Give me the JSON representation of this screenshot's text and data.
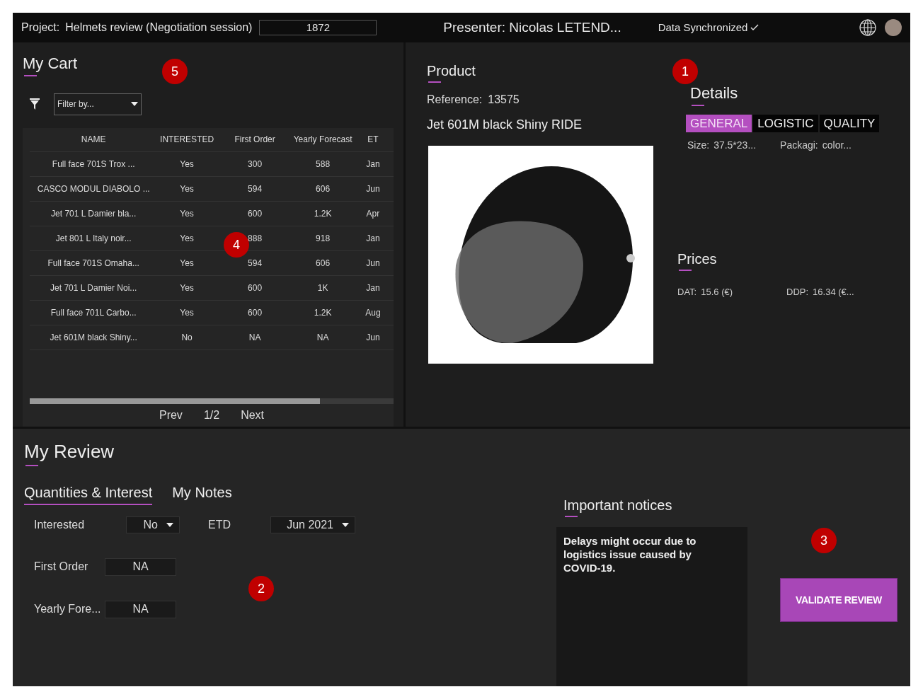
{
  "top_bar": {
    "project_label": "Project:",
    "project_name": "Helmets review (Negotiation session)",
    "project_code": "1872",
    "presenter": "Presenter: Nicolas LETEND...",
    "sync_status": "Data Synchronized"
  },
  "cart": {
    "title": "My Cart",
    "filter": {
      "placeholder": "Filter by..."
    },
    "table": {
      "columns": [
        "NAME",
        "INTERESTED",
        "First Order",
        "Yearly Forecast",
        "ET"
      ],
      "rows": [
        [
          "Full face 701S Trox ...",
          "Yes",
          "300",
          "588",
          "Jan"
        ],
        [
          "CASCO MODUL DIABOLO ...",
          "Yes",
          "594",
          "606",
          "Jun"
        ],
        [
          "Jet 701 L Damier bla...",
          "Yes",
          "600",
          "1.2K",
          "Apr"
        ],
        [
          "Jet 801 L Italy noir...",
          "Yes",
          "888",
          "918",
          "Jan"
        ],
        [
          "Full face 701S Omaha...",
          "Yes",
          "594",
          "606",
          "Jun"
        ],
        [
          "Jet 701 L Damier Noi...",
          "Yes",
          "600",
          "1K",
          "Jan"
        ],
        [
          "Full face 701L Carbo...",
          "Yes",
          "600",
          "1.2K",
          "Aug"
        ],
        [
          "Jet 601M black Shiny...",
          "No",
          "NA",
          "NA",
          "Jun"
        ]
      ]
    },
    "pagination": {
      "prev": "Prev",
      "page": "1/2",
      "next": "Next"
    }
  },
  "product": {
    "title": "Product",
    "reference_label": "Reference:",
    "reference": "13575",
    "name": "Jet 601M black Shiny RIDE",
    "details": {
      "title": "Details",
      "tabs": [
        {
          "label": "GENERAL",
          "selected": true
        },
        {
          "label": "LOGISTIC",
          "selected": false
        },
        {
          "label": "QUALITY",
          "selected": false
        }
      ],
      "fields": [
        {
          "label": "Size:",
          "value": "37.5*23..."
        },
        {
          "label": "Packagi:",
          "value": "color..."
        }
      ]
    },
    "prices": {
      "title": "Prices",
      "fields": [
        {
          "label": "DAT:",
          "value": "15.6 (€)"
        },
        {
          "label": "DDP:",
          "value": "16.34 (€..."
        }
      ]
    }
  },
  "review": {
    "title": "My Review",
    "tabs": [
      {
        "label": "Quantities & Interest",
        "selected": true
      },
      {
        "label": "My Notes",
        "selected": false
      }
    ],
    "interested": {
      "label": "Interested",
      "value": "No"
    },
    "etd": {
      "label": "ETD",
      "value": "Jun 2021"
    },
    "first_order": {
      "label": "First Order",
      "value": "NA"
    },
    "yearly_forecast": {
      "label": "Yearly Fore...",
      "value": "NA"
    }
  },
  "notices": {
    "title": "Important notices",
    "text": "Delays might occur due to logistics issue caused by COVID-19."
  },
  "validate_button": "VALIDATE REVIEW",
  "callouts": [
    "1",
    "5",
    "4",
    "2",
    "3"
  ]
}
